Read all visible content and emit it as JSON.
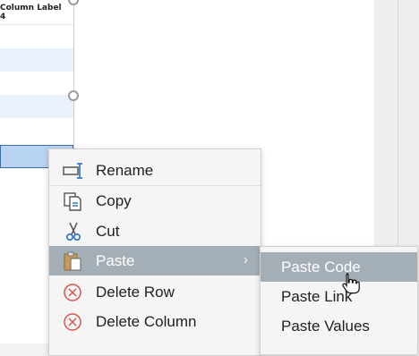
{
  "table": {
    "column_header": "Column Label 4"
  },
  "context_menu": {
    "items": [
      {
        "label": "Rename",
        "icon": "rename-icon"
      },
      {
        "label": "Copy",
        "icon": "copy-icon"
      },
      {
        "label": "Cut",
        "icon": "scissors-icon"
      },
      {
        "label": "Paste",
        "icon": "paste-icon",
        "submenu_arrow": "›",
        "highlighted": true
      },
      {
        "label": "Delete Row",
        "icon": "delete-circle-icon"
      },
      {
        "label": "Delete Column",
        "icon": "delete-circle-icon"
      }
    ]
  },
  "paste_submenu": {
    "items": [
      {
        "label": "Paste Code",
        "highlighted": true
      },
      {
        "label": "Paste Link"
      },
      {
        "label": "Paste Values"
      }
    ]
  },
  "colors": {
    "highlight": "#a4aeb7",
    "delete_icon": "#d9534f",
    "selected_row": "#b9d3f2"
  }
}
